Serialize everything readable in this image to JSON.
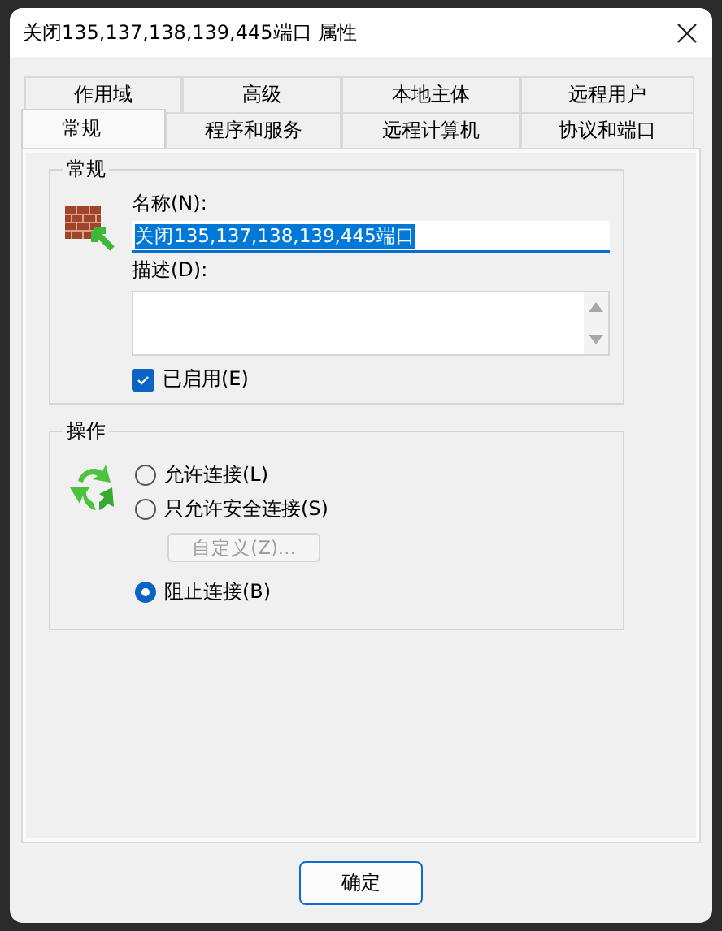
{
  "window": {
    "title": "关闭135,137,138,139,445端口 属性"
  },
  "tab_rows": [
    {
      "tabs": [
        {
          "label": "作用域",
          "selected": false
        },
        {
          "label": "高级",
          "selected": false
        },
        {
          "label": "本地主体",
          "selected": false
        },
        {
          "label": "远程用户",
          "selected": false
        }
      ]
    },
    {
      "tabs": [
        {
          "label": "常规",
          "selected": true
        },
        {
          "label": "程序和服务",
          "selected": false
        },
        {
          "label": "远程计算机",
          "selected": false
        },
        {
          "label": "协议和端口",
          "selected": false
        }
      ]
    }
  ],
  "general": {
    "title": "常规",
    "name_label": "名称(N):",
    "name_value": "关闭135,137,138,139,445端口",
    "description_label": "描述(D):",
    "enabled": {
      "label": "已启用(E)",
      "checked": true
    }
  },
  "action": {
    "title": "操作",
    "controls": [
      {
        "kind": "radio",
        "label": "允许连接(L)",
        "selected": false
      },
      {
        "kind": "radio",
        "label": "只允许安全连接(S)",
        "selected": false
      },
      {
        "kind": "button",
        "label": "自定义(Z)...",
        "disabled": true
      },
      {
        "kind": "radio",
        "label": "阻止连接(B)",
        "selected": true
      }
    ]
  },
  "buttons": [
    {
      "label": "确定"
    }
  ]
}
